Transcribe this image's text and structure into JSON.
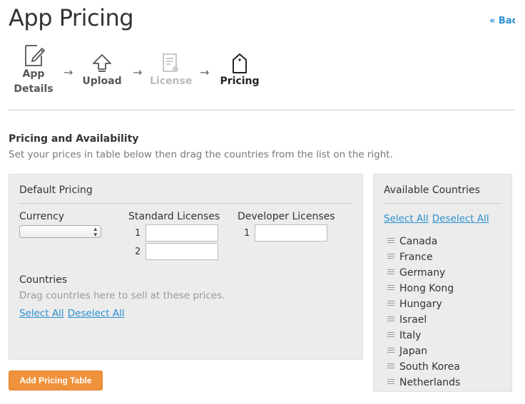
{
  "page": {
    "title": "App Pricing",
    "back_label": "« Back"
  },
  "wizard": {
    "steps": [
      {
        "label_line1": "App",
        "label_line2": "Details",
        "icon": "edit-document-icon",
        "state": "done"
      },
      {
        "label": "Upload",
        "icon": "upload-arrow-icon",
        "state": "done"
      },
      {
        "label": "License",
        "icon": "license-certificate-icon",
        "state": "disabled"
      },
      {
        "label": "Pricing",
        "icon": "price-tag-icon",
        "state": "active"
      }
    ],
    "separator": "→"
  },
  "section": {
    "title": "Pricing and Availability",
    "subtitle": "Set your prices in table below then drag the countries from the list on the right."
  },
  "default_pricing": {
    "title": "Default Pricing",
    "currency_label": "Currency",
    "currency_value": "",
    "standard_label": "Standard Licenses",
    "standard_rows": [
      {
        "num": "1",
        "value": ""
      },
      {
        "num": "2",
        "value": ""
      }
    ],
    "developer_label": "Developer Licenses",
    "developer_rows": [
      {
        "num": "1",
        "value": ""
      }
    ],
    "countries_label": "Countries",
    "countries_hint": "Drag countries here to sell at these prices.",
    "select_all": "Select All",
    "deselect_all": "Deselect All"
  },
  "add_button": "Add Pricing Table",
  "available": {
    "title": "Available Countries",
    "select_all": "Select All",
    "deselect_all": "Deselect All",
    "countries": [
      "Canada",
      "France",
      "Germany",
      "Hong Kong",
      "Hungary",
      "Israel",
      "Italy",
      "Japan",
      "South Korea",
      "Netherlands"
    ]
  },
  "colors": {
    "accent_link": "#2a8fd0",
    "button_orange": "#f0923b",
    "panel_bg": "#ececec"
  }
}
